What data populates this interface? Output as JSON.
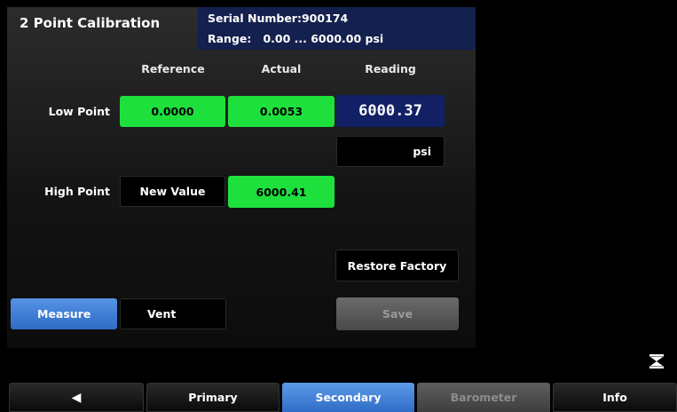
{
  "header": {
    "title": "2 Point Calibration",
    "serial_number": "Serial Number:900174",
    "range": "Range:   0.00 ... 6000.00 psi"
  },
  "columns": {
    "reference": "Reference",
    "actual": "Actual",
    "reading": "Reading"
  },
  "low_point": {
    "label": "Low Point",
    "reference": "0.0000",
    "actual": "0.0053",
    "reading": "6000.37",
    "unit": "psi"
  },
  "high_point": {
    "label": "High Point",
    "reference": "New Value",
    "actual": "6000.41"
  },
  "buttons": {
    "restore_factory": "Restore Factory",
    "measure": "Measure",
    "vent": "Vent",
    "save": "Save"
  },
  "tabs": {
    "back": "◀",
    "primary": "Primary",
    "secondary": "Secondary",
    "barometer": "Barometer",
    "info": "Info"
  },
  "icons": {
    "back": "left-arrow-icon",
    "collapse": "hourglass-collapse-icon"
  },
  "colors": {
    "active": "#2e6bc4",
    "value_ok": "#1ee03d",
    "reading_bg": "#122066",
    "serial_bg": "#14204e"
  }
}
